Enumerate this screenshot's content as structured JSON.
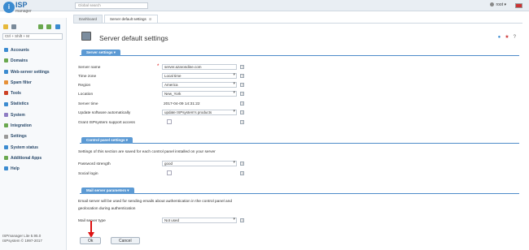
{
  "header": {
    "logo_main": "ISP",
    "logo_sub": "manager",
    "search_placeholder": "Global search",
    "user": "root"
  },
  "sidebar": {
    "filter_text": "Ctrl + Shift + M",
    "items": [
      {
        "label": "Accounts",
        "color": "#3b8bd0"
      },
      {
        "label": "Domains",
        "color": "#6aa84f"
      },
      {
        "label": "Web-server settings",
        "color": "#3b8bd0"
      },
      {
        "label": "Spam filter",
        "color": "#e69138"
      },
      {
        "label": "Tools",
        "color": "#cc4125"
      },
      {
        "label": "Statistics",
        "color": "#3b8bd0"
      },
      {
        "label": "System",
        "color": "#8e7cc3"
      },
      {
        "label": "Integration",
        "color": "#6aa84f"
      },
      {
        "label": "Settings",
        "color": "#999999"
      },
      {
        "label": "System status",
        "color": "#3b8bd0"
      },
      {
        "label": "Additional Apps",
        "color": "#6aa84f"
      },
      {
        "label": "Help",
        "color": "#3b8bd0"
      }
    ],
    "footer_line1": "ISPmanager Lite 5.95.0",
    "footer_line2": "ISPsystem © 1997-2017"
  },
  "tabs": {
    "dashboard": "Dashboard",
    "server_default": "Server default settings"
  },
  "page": {
    "title": "Server default settings"
  },
  "sections": {
    "server_settings": "Server settings",
    "control_panel": "Control panel settings",
    "mail_server": "Mail server parameters"
  },
  "server_settings": {
    "server_name_label": "Server name",
    "server_name_value": "server.azarondine.com",
    "time_zone_label": "Time zone",
    "time_zone_value": "Local time",
    "region_label": "Region",
    "region_value": "America",
    "location_label": "Location",
    "location_value": "New_York",
    "server_time_label": "Server time",
    "server_time_value": "2017-04-09 14:31:22",
    "update_label": "Update software automatically",
    "update_value": "update ISPsystem's products",
    "grant_label": "Grant ISPsystem support access"
  },
  "control_panel": {
    "note": "Settings of this section are saved for each control panel installed on your server",
    "password_label": "Password strength",
    "password_value": "good",
    "social_label": "Social login"
  },
  "mail_server": {
    "note_line1": "Email server will be used for sending emails about authentication in the control panel and",
    "note_line2": "geolocation during authentication",
    "type_label": "Mail server type",
    "type_value": "Not used"
  },
  "buttons": {
    "ok": "Ok",
    "cancel": "Cancel"
  }
}
